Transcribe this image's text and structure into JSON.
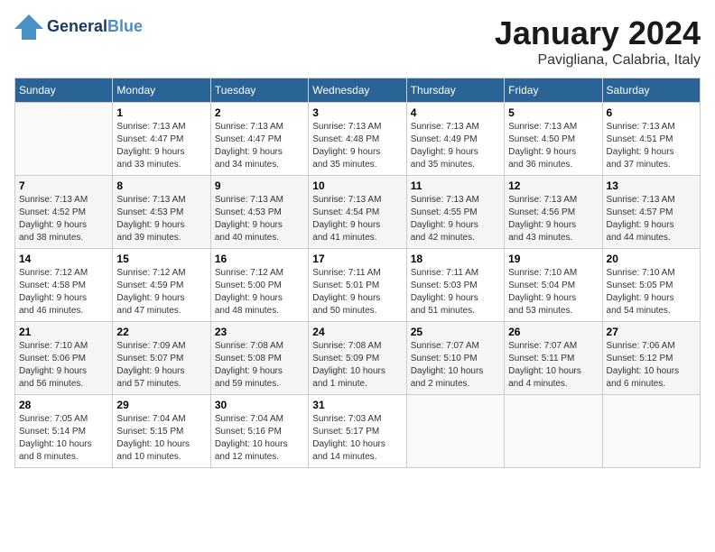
{
  "header": {
    "logo_line1": "General",
    "logo_line2": "Blue",
    "month": "January 2024",
    "location": "Pavigliana, Calabria, Italy"
  },
  "weekdays": [
    "Sunday",
    "Monday",
    "Tuesday",
    "Wednesday",
    "Thursday",
    "Friday",
    "Saturday"
  ],
  "weeks": [
    [
      {
        "day": "",
        "info": ""
      },
      {
        "day": "1",
        "info": "Sunrise: 7:13 AM\nSunset: 4:47 PM\nDaylight: 9 hours\nand 33 minutes."
      },
      {
        "day": "2",
        "info": "Sunrise: 7:13 AM\nSunset: 4:47 PM\nDaylight: 9 hours\nand 34 minutes."
      },
      {
        "day": "3",
        "info": "Sunrise: 7:13 AM\nSunset: 4:48 PM\nDaylight: 9 hours\nand 35 minutes."
      },
      {
        "day": "4",
        "info": "Sunrise: 7:13 AM\nSunset: 4:49 PM\nDaylight: 9 hours\nand 35 minutes."
      },
      {
        "day": "5",
        "info": "Sunrise: 7:13 AM\nSunset: 4:50 PM\nDaylight: 9 hours\nand 36 minutes."
      },
      {
        "day": "6",
        "info": "Sunrise: 7:13 AM\nSunset: 4:51 PM\nDaylight: 9 hours\nand 37 minutes."
      }
    ],
    [
      {
        "day": "7",
        "info": "Sunrise: 7:13 AM\nSunset: 4:52 PM\nDaylight: 9 hours\nand 38 minutes."
      },
      {
        "day": "8",
        "info": "Sunrise: 7:13 AM\nSunset: 4:53 PM\nDaylight: 9 hours\nand 39 minutes."
      },
      {
        "day": "9",
        "info": "Sunrise: 7:13 AM\nSunset: 4:53 PM\nDaylight: 9 hours\nand 40 minutes."
      },
      {
        "day": "10",
        "info": "Sunrise: 7:13 AM\nSunset: 4:54 PM\nDaylight: 9 hours\nand 41 minutes."
      },
      {
        "day": "11",
        "info": "Sunrise: 7:13 AM\nSunset: 4:55 PM\nDaylight: 9 hours\nand 42 minutes."
      },
      {
        "day": "12",
        "info": "Sunrise: 7:13 AM\nSunset: 4:56 PM\nDaylight: 9 hours\nand 43 minutes."
      },
      {
        "day": "13",
        "info": "Sunrise: 7:13 AM\nSunset: 4:57 PM\nDaylight: 9 hours\nand 44 minutes."
      }
    ],
    [
      {
        "day": "14",
        "info": "Sunrise: 7:12 AM\nSunset: 4:58 PM\nDaylight: 9 hours\nand 46 minutes."
      },
      {
        "day": "15",
        "info": "Sunrise: 7:12 AM\nSunset: 4:59 PM\nDaylight: 9 hours\nand 47 minutes."
      },
      {
        "day": "16",
        "info": "Sunrise: 7:12 AM\nSunset: 5:00 PM\nDaylight: 9 hours\nand 48 minutes."
      },
      {
        "day": "17",
        "info": "Sunrise: 7:11 AM\nSunset: 5:01 PM\nDaylight: 9 hours\nand 50 minutes."
      },
      {
        "day": "18",
        "info": "Sunrise: 7:11 AM\nSunset: 5:03 PM\nDaylight: 9 hours\nand 51 minutes."
      },
      {
        "day": "19",
        "info": "Sunrise: 7:10 AM\nSunset: 5:04 PM\nDaylight: 9 hours\nand 53 minutes."
      },
      {
        "day": "20",
        "info": "Sunrise: 7:10 AM\nSunset: 5:05 PM\nDaylight: 9 hours\nand 54 minutes."
      }
    ],
    [
      {
        "day": "21",
        "info": "Sunrise: 7:10 AM\nSunset: 5:06 PM\nDaylight: 9 hours\nand 56 minutes."
      },
      {
        "day": "22",
        "info": "Sunrise: 7:09 AM\nSunset: 5:07 PM\nDaylight: 9 hours\nand 57 minutes."
      },
      {
        "day": "23",
        "info": "Sunrise: 7:08 AM\nSunset: 5:08 PM\nDaylight: 9 hours\nand 59 minutes."
      },
      {
        "day": "24",
        "info": "Sunrise: 7:08 AM\nSunset: 5:09 PM\nDaylight: 10 hours\nand 1 minute."
      },
      {
        "day": "25",
        "info": "Sunrise: 7:07 AM\nSunset: 5:10 PM\nDaylight: 10 hours\nand 2 minutes."
      },
      {
        "day": "26",
        "info": "Sunrise: 7:07 AM\nSunset: 5:11 PM\nDaylight: 10 hours\nand 4 minutes."
      },
      {
        "day": "27",
        "info": "Sunrise: 7:06 AM\nSunset: 5:12 PM\nDaylight: 10 hours\nand 6 minutes."
      }
    ],
    [
      {
        "day": "28",
        "info": "Sunrise: 7:05 AM\nSunset: 5:14 PM\nDaylight: 10 hours\nand 8 minutes."
      },
      {
        "day": "29",
        "info": "Sunrise: 7:04 AM\nSunset: 5:15 PM\nDaylight: 10 hours\nand 10 minutes."
      },
      {
        "day": "30",
        "info": "Sunrise: 7:04 AM\nSunset: 5:16 PM\nDaylight: 10 hours\nand 12 minutes."
      },
      {
        "day": "31",
        "info": "Sunrise: 7:03 AM\nSunset: 5:17 PM\nDaylight: 10 hours\nand 14 minutes."
      },
      {
        "day": "",
        "info": ""
      },
      {
        "day": "",
        "info": ""
      },
      {
        "day": "",
        "info": ""
      }
    ]
  ]
}
